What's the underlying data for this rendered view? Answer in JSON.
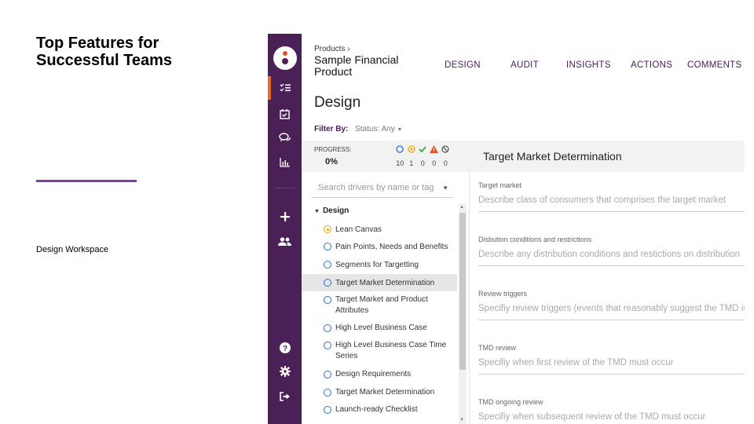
{
  "slide": {
    "title": "Top Features for\nSuccessful Teams",
    "caption": "Design Workspace",
    "accent_color": "#7b3fa0"
  },
  "app": {
    "rail": {
      "color": "#4a2056",
      "icons": [
        "logo-icon",
        "checklist-icon",
        "calendar-check-icon",
        "comments-icon",
        "bar-chart-icon",
        "plus-icon",
        "users-icon",
        "help-icon",
        "gear-icon",
        "logout-icon"
      ]
    },
    "header": {
      "breadcrumb": "Products",
      "product_name": "Sample Financial Product",
      "tabs": [
        "DESIGN",
        "AUDIT",
        "INSIGHTS",
        "ACTIONS",
        "COMMENTS"
      ]
    },
    "page_title": "Design",
    "filter": {
      "label": "Filter By:",
      "value": "Status: Any"
    },
    "progress": {
      "label": "PROGRESS:",
      "value": "0%",
      "status_counts": [
        {
          "icon": "circle-outline-icon",
          "count": "10"
        },
        {
          "icon": "circle-dot-icon",
          "count": "1"
        },
        {
          "icon": "check-icon",
          "count": "0"
        },
        {
          "icon": "warning-icon",
          "count": "0"
        },
        {
          "icon": "blocked-icon",
          "count": "0"
        }
      ]
    },
    "search": {
      "placeholder": "Search drivers by name or tag"
    },
    "tree": {
      "group": "Design",
      "items": [
        {
          "label": "Lean Canvas",
          "status": "in-progress"
        },
        {
          "label": "Pain Points, Needs and Benefits",
          "status": "open"
        },
        {
          "label": "Segments for Targetting",
          "status": "open"
        },
        {
          "label": "Target Market Determination",
          "status": "open",
          "selected": true
        },
        {
          "label": "Target Market and Product Attributes",
          "status": "open"
        },
        {
          "label": "High Level Business Case",
          "status": "open"
        },
        {
          "label": "High Level Business Case Time Series",
          "status": "open"
        },
        {
          "label": "Design Requirements",
          "status": "open"
        },
        {
          "label": "Target Market Determination",
          "status": "open"
        },
        {
          "label": "Launch-ready Checklist",
          "status": "open"
        }
      ]
    },
    "detail": {
      "title": "Target Market Determination",
      "fields": [
        {
          "label": "Target market",
          "placeholder": "Describe class of consumers that comprises the target market"
        },
        {
          "label": "Disbution conditions and restrictions",
          "placeholder": "Describe any distribution conditions and restictions on distribution"
        },
        {
          "label": "Review triggers",
          "placeholder": "Specifiy review triggers (events that reasonably suggest the TMD is"
        },
        {
          "label": "TMD review",
          "placeholder": "Specifiy when first review of the TMD must occur"
        },
        {
          "label": "TMD ongoing review",
          "placeholder": "Specifiy when subsequent review of the TMD must occur"
        }
      ]
    }
  }
}
